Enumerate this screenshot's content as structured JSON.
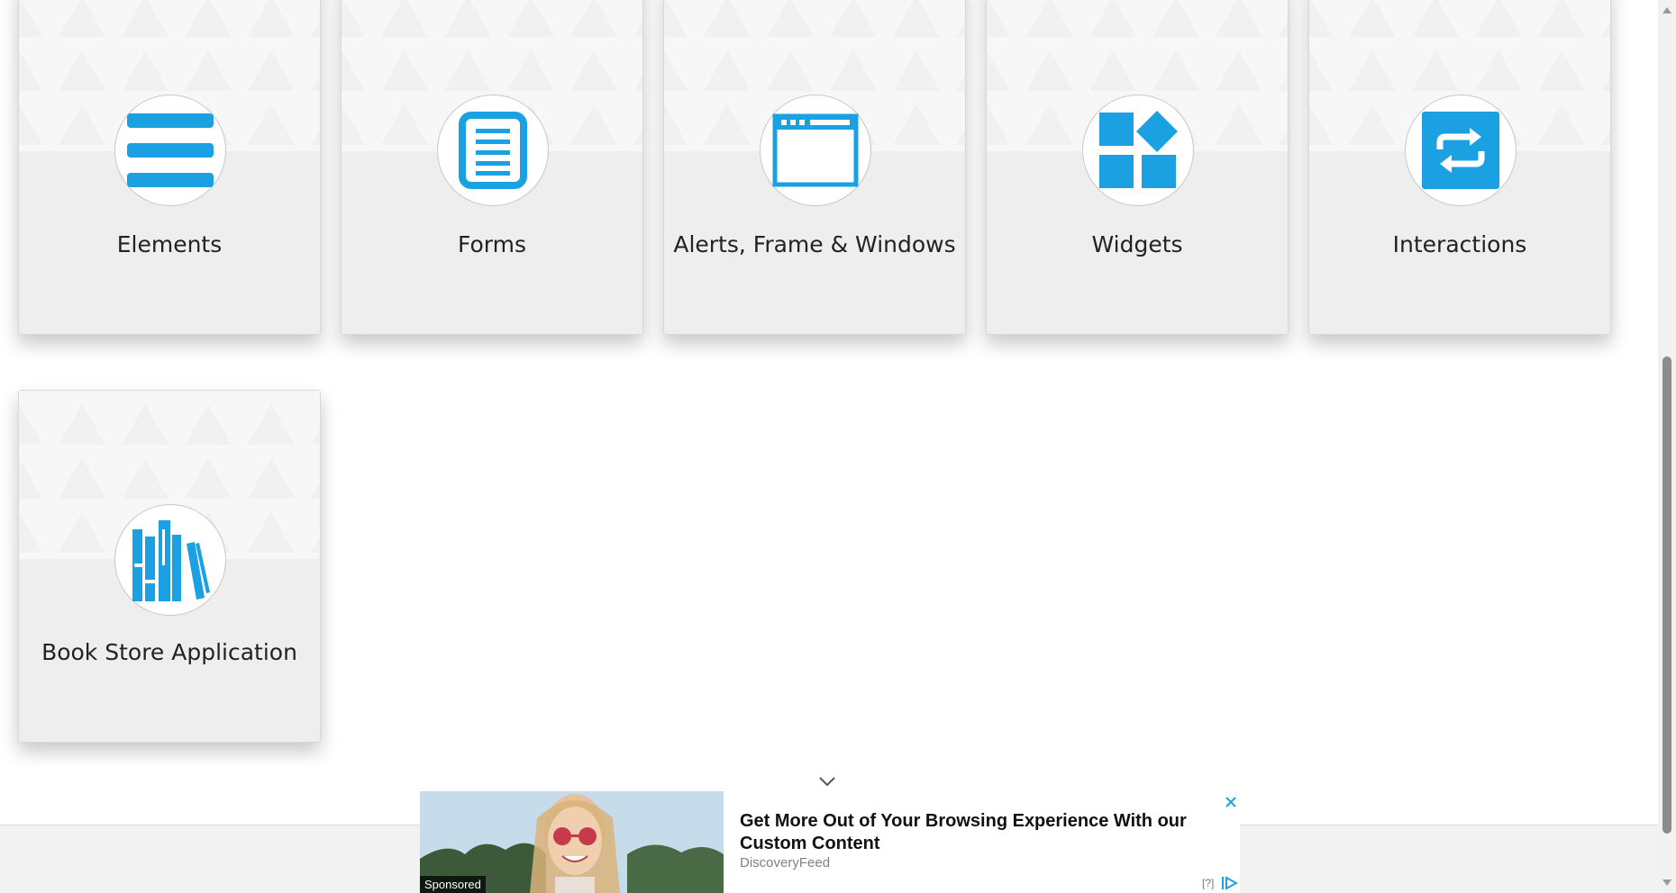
{
  "cards": [
    {
      "title": "Elements",
      "icon": "list-lines-icon"
    },
    {
      "title": "Forms",
      "icon": "document-icon"
    },
    {
      "title": "Alerts, Frame & Windows",
      "icon": "browser-window-icon"
    },
    {
      "title": "Widgets",
      "icon": "widgets-icon"
    },
    {
      "title": "Interactions",
      "icon": "repeat-arrows-icon"
    },
    {
      "title": "Book Store Application",
      "icon": "books-icon"
    }
  ],
  "ad": {
    "label": "Sponsored",
    "headline": "Get More Out of Your Browsing Experience With our Custom Content",
    "advertiser": "DiscoveryFeed",
    "help": "[?]"
  },
  "colors": {
    "accent": "#1ba0e1",
    "card_bg": "#eeeeee"
  }
}
